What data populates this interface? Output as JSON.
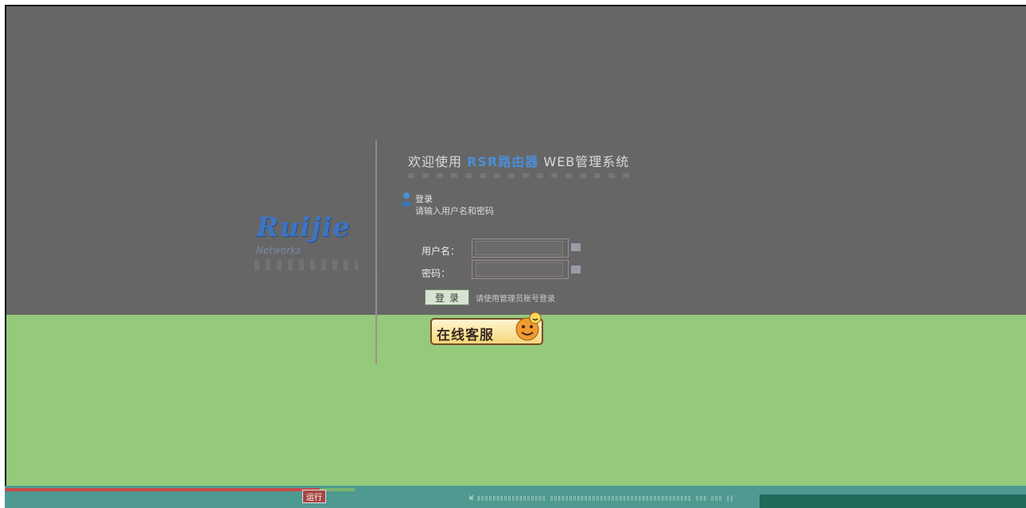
{
  "app": {
    "welcome_prefix": "欢迎使用",
    "brand": "RSR路由器",
    "welcome_suffix": "WEB管理系统"
  },
  "logo": {
    "word": "Ruijie",
    "sub": "Networks"
  },
  "hint": {
    "title": "登录",
    "text": "请输入用户名和密码"
  },
  "form": {
    "username_label": "用户名：",
    "password_label": "密码：",
    "username_value": "",
    "password_value": "",
    "login_label": "登录",
    "note": "请使用管理员账号登录"
  },
  "service": {
    "label": "在线客服"
  },
  "status": {
    "left_label": "运行",
    "glyphs": "W  ▯▯▯▯▯▯▯▯▯▯▯▯▯▯▯▯▯▯  ▯▯▯▯▯▯▯▯▯▯▯▯▯▯▯▯▯▯▯▯▯▯▯▯▯▯▯▯▯▯▯▯▯▯▯▯▯  ▯▯▯  ▯▯▯  ||"
  },
  "colors": {
    "top_bg": "#666666",
    "bottom_bg": "#95c97b",
    "brand_blue": "#4a8fd6",
    "status_teal": "#4e9990"
  }
}
